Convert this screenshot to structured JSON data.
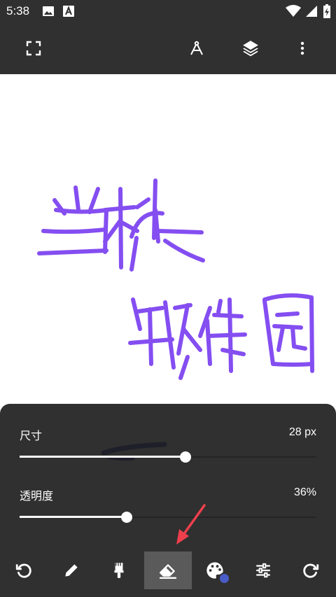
{
  "status_bar": {
    "time": "5:38",
    "icons": [
      "image-notification-icon",
      "a-notification-icon",
      "wifi-icon",
      "cellular-icon",
      "battery-charging-icon"
    ]
  },
  "toolbar": {
    "left": [
      "fullscreen-icon"
    ],
    "right": [
      "compass-icon",
      "layers-icon",
      "more-vert-icon"
    ]
  },
  "colors": {
    "dark_bg": "#303030",
    "stroke_purple": "#7a3ff0",
    "palette_dot": "#4a5cc7",
    "arrow_red": "#ef3f4c"
  },
  "brush_panel": {
    "size": {
      "label": "尺寸",
      "value": "28 px",
      "fraction": 0.56
    },
    "opacity": {
      "label": "透明度",
      "value": "36%",
      "fraction": 0.36
    }
  },
  "bottom_tools": [
    {
      "icon": "undo-icon",
      "selected": false
    },
    {
      "icon": "pencil-icon",
      "selected": false
    },
    {
      "icon": "brush-icon",
      "selected": false
    },
    {
      "icon": "eraser-icon",
      "selected": true
    },
    {
      "icon": "palette-icon",
      "selected": false
    },
    {
      "icon": "sliders-icon",
      "selected": false
    },
    {
      "icon": "redo-icon",
      "selected": false
    }
  ]
}
